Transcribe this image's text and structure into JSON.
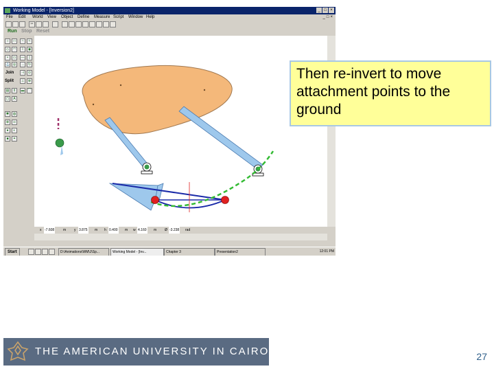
{
  "app": {
    "title": "Working Model - [Inversion2]",
    "window_buttons": [
      "_",
      "□",
      "×"
    ],
    "menu": [
      "File",
      "Edit",
      "World",
      "View",
      "Object",
      "Define",
      "Measure",
      "Script",
      "Window",
      "Help"
    ],
    "run_buttons": {
      "run": "Run",
      "stop": "Stop",
      "reset": "Reset"
    },
    "palette_labels": {
      "join": "Join",
      "split": "Split"
    }
  },
  "coords": {
    "x_label": "x",
    "x_value": "-7.608",
    "x_unit": "m",
    "y_label": "y",
    "y_value": "3.875",
    "y_unit": "m",
    "h_label": "h",
    "h_value": "0.400",
    "h_unit": "m",
    "w_label": "w",
    "w_value": "4.160",
    "w_unit": "m",
    "phi_label": "Ø",
    "phi_value": "-3.238",
    "phi_unit": "rad"
  },
  "taskbar": {
    "start": "Start",
    "tasks": [
      "D:\\Animations\\WM\\J\\Sp...",
      "Working Model - [Inv...",
      "Chapter 3",
      "Presentation2"
    ],
    "clock": "12:01 PM"
  },
  "callout": "Then re-invert to move attachment points to the ground",
  "logo_text": "THE AMERICAN UNIVERSITY IN CAIRO",
  "page_number": "27",
  "colors": {
    "body_fill": "#f4b87a",
    "link_fill": "#9ec8ec",
    "callout_bg": "#ffff99",
    "callout_border": "#a8c8e4",
    "logo_bg": "#5a6b82",
    "path_green": "#33bb33",
    "point_red": "#e02020",
    "link_blue": "#1a2aa8"
  }
}
